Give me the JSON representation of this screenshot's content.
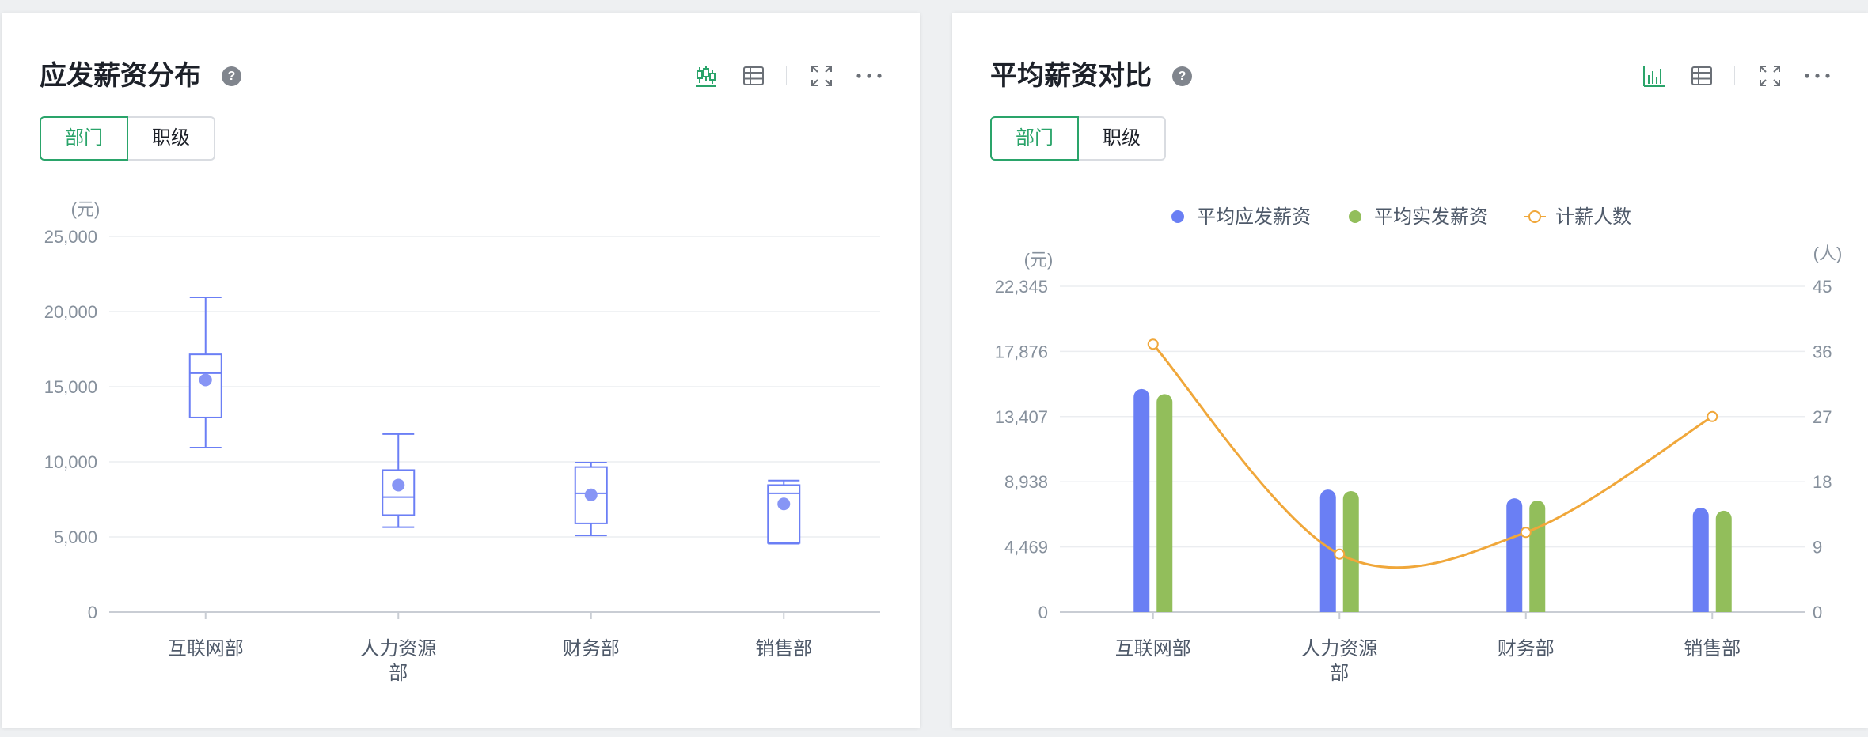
{
  "colors": {
    "accent": "#2aa46a",
    "boxplot": "#6b7ff5",
    "bar_blue": "#6a7ff4",
    "bar_green": "#92be5b",
    "line_orange": "#f0a73a"
  },
  "cards": [
    {
      "title": "应发薪资分布",
      "help": "?",
      "segments": [
        "部门",
        "职级"
      ],
      "active_segment": "部门",
      "toolbar_icons": [
        "boxplot-chart-icon",
        "table-icon",
        "fullscreen-icon",
        "more-icon"
      ]
    },
    {
      "title": "平均薪资对比",
      "help": "?",
      "segments": [
        "部门",
        "职级"
      ],
      "active_segment": "部门",
      "toolbar_icons": [
        "bar-chart-icon",
        "table-icon",
        "fullscreen-icon",
        "more-icon"
      ]
    }
  ],
  "chart_data": [
    {
      "type": "boxplot",
      "unit": "(元)",
      "categories": [
        [
          "互联网部"
        ],
        [
          "人力资源",
          "部"
        ],
        [
          "财务部"
        ],
        [
          "销售部"
        ]
      ],
      "y_ticks": [
        "0",
        "5,000",
        "10,000",
        "15,000",
        "20,000",
        "25,000"
      ],
      "ylim": [
        0,
        25000
      ],
      "boxes": [
        {
          "min": 10950,
          "q1": 12950,
          "median": 15900,
          "q3": 17150,
          "max": 20950,
          "mean": 15450
        },
        {
          "min": 5650,
          "q1": 6450,
          "median": 7650,
          "q3": 9450,
          "max": 11850,
          "mean": 8450
        },
        {
          "min": 5100,
          "q1": 5900,
          "median": 7900,
          "q3": 9650,
          "max": 9950,
          "mean": 7800
        },
        {
          "min": 4550,
          "q1": 4600,
          "median": 7900,
          "q3": 8450,
          "max": 8750,
          "mean": 7200
        }
      ]
    },
    {
      "type": "bar",
      "unit_left": "(元)",
      "unit_right": "(人)",
      "categories": [
        [
          "互联网部"
        ],
        [
          "人力资源",
          "部"
        ],
        [
          "财务部"
        ],
        [
          "销售部"
        ]
      ],
      "y_ticks": [
        "0",
        "4,469",
        "8,938",
        "13,407",
        "17,876",
        "22,345"
      ],
      "ylim": [
        0,
        22345
      ],
      "y2_ticks": [
        "0",
        "9",
        "18",
        "27",
        "36",
        "45"
      ],
      "y2lim": [
        0,
        45
      ],
      "legend": [
        "平均应发薪资",
        "平均实发薪资",
        "计薪人数"
      ],
      "series": [
        {
          "name": "平均应发薪资",
          "kind": "bar",
          "values": [
            15300,
            8400,
            7800,
            7150
          ]
        },
        {
          "name": "平均实发薪资",
          "kind": "bar",
          "values": [
            14950,
            8300,
            7650,
            6950
          ]
        },
        {
          "name": "计薪人数",
          "kind": "line",
          "axis": "right",
          "values": [
            37,
            8,
            11,
            27
          ]
        }
      ]
    }
  ]
}
